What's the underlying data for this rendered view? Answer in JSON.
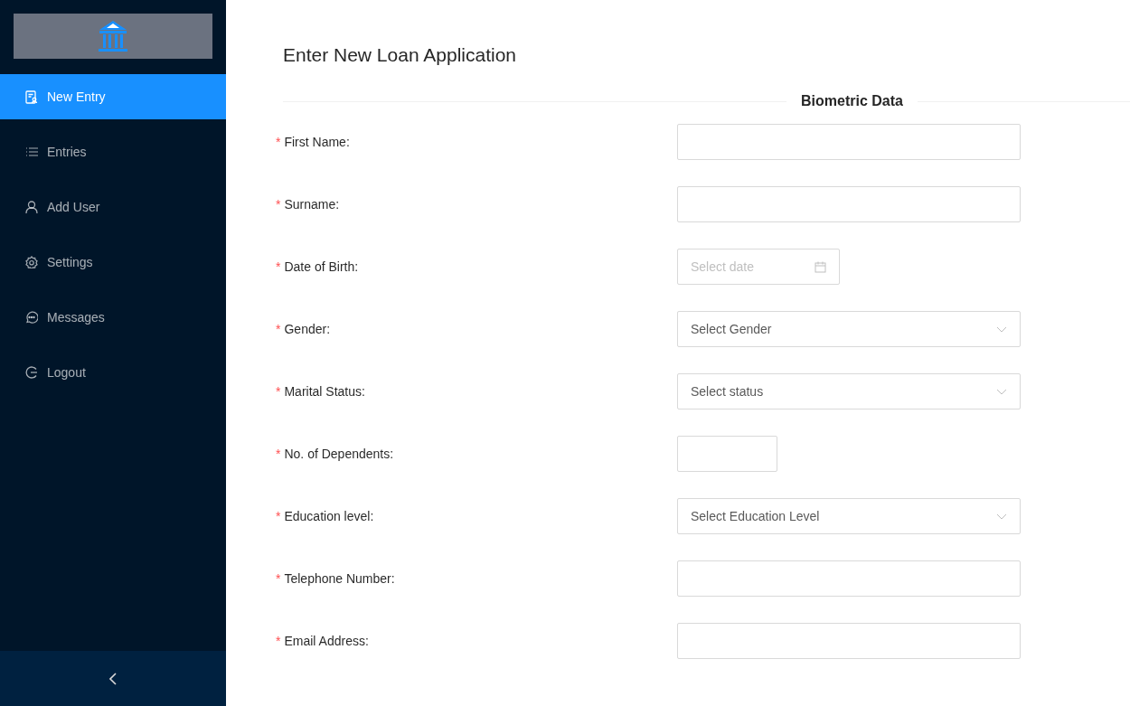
{
  "sidebar": {
    "items": [
      {
        "label": "New Entry",
        "selected": true
      },
      {
        "label": "Entries",
        "selected": false
      },
      {
        "label": "Add User",
        "selected": false
      },
      {
        "label": "Settings",
        "selected": false
      },
      {
        "label": "Messages",
        "selected": false
      },
      {
        "label": "Logout",
        "selected": false
      }
    ]
  },
  "page_title": "Enter New Loan Application",
  "section_title": "Biometric Data",
  "required_mark": "*",
  "fields": [
    {
      "label": "First Name:",
      "kind": "text",
      "required": true
    },
    {
      "label": "Surname:",
      "kind": "text",
      "required": true
    },
    {
      "label": "Date of Birth:",
      "kind": "date",
      "placeholder": "Select date",
      "required": true
    },
    {
      "label": "Gender:",
      "kind": "select",
      "placeholder": "Select Gender",
      "required": true
    },
    {
      "label": "Marital Status:",
      "kind": "select",
      "placeholder": "Select status",
      "required": true
    },
    {
      "label": "No. of Dependents:",
      "kind": "number",
      "required": true
    },
    {
      "label": "Education level:",
      "kind": "select",
      "placeholder": "Select Education Level",
      "required": true
    },
    {
      "label": "Telephone Number:",
      "kind": "text",
      "required": true
    },
    {
      "label": "Email Address:",
      "kind": "text",
      "required": true
    }
  ]
}
